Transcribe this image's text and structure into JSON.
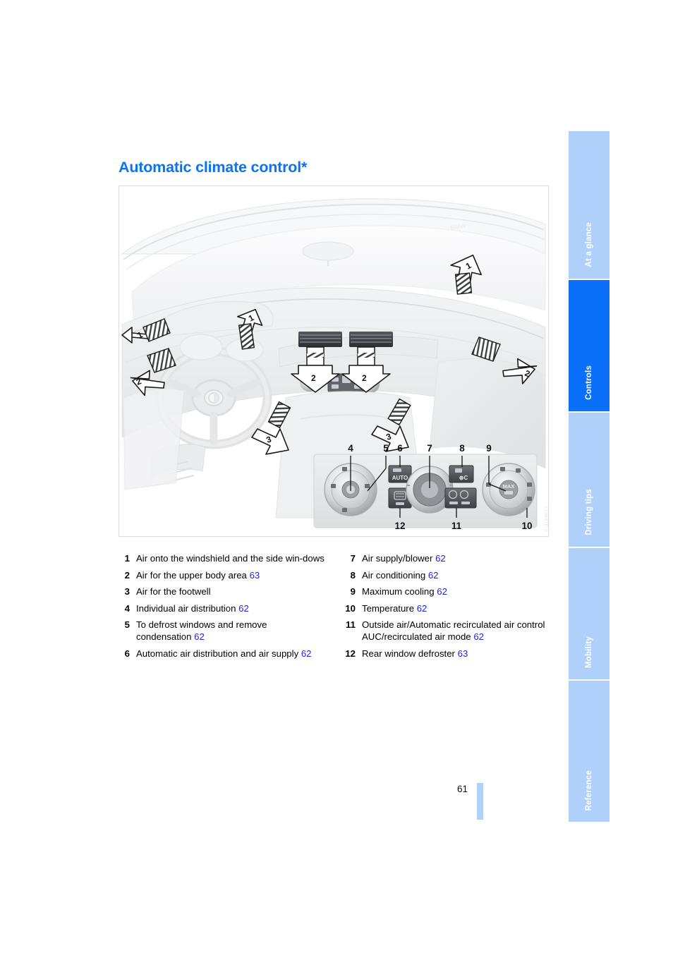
{
  "document": {
    "title": "Automatic climate control*",
    "page_number": "61",
    "figure_id": "CLIMATE-IL"
  },
  "legend": {
    "left": [
      {
        "num": "1",
        "text": "Air onto the windshield and the side win-dows",
        "ref": ""
      },
      {
        "num": "2",
        "text": "Air for the upper body area",
        "ref": "63"
      },
      {
        "num": "3",
        "text": "Air for the footwell",
        "ref": ""
      },
      {
        "num": "4",
        "text": "Individual air distribution",
        "ref": "62"
      },
      {
        "num": "5",
        "text": "To defrost windows and remove condensation",
        "ref": "62"
      },
      {
        "num": "6",
        "text": "Automatic air distribution and air supply",
        "ref": "62"
      }
    ],
    "right": [
      {
        "num": "7",
        "text": "Air supply/blower",
        "ref": "62"
      },
      {
        "num": "8",
        "text": "Air conditioning",
        "ref": "62"
      },
      {
        "num": "9",
        "text": "Maximum cooling",
        "ref": "62"
      },
      {
        "num": "10",
        "text": "Temperature",
        "ref": "62"
      },
      {
        "num": "11",
        "text": "Outside air/Automatic recirculated air control AUC/recirculated air mode",
        "ref": "62"
      },
      {
        "num": "12",
        "text": "Rear window defroster",
        "ref": "63"
      }
    ]
  },
  "sidebar": {
    "tabs": [
      {
        "label": "At a glance",
        "active": false
      },
      {
        "label": "Controls",
        "active": true
      },
      {
        "label": "Driving tips",
        "active": false
      },
      {
        "label": "Mobility",
        "active": false
      },
      {
        "label": "Reference",
        "active": false
      }
    ]
  },
  "figure": {
    "callouts_top": [
      "4",
      "5",
      "6",
      "7",
      "8",
      "9"
    ],
    "callouts_bottom": [
      "12",
      "11",
      "10"
    ],
    "arrow_labels": [
      "1",
      "1",
      "1",
      "2",
      "2",
      "2",
      "2",
      "3",
      "3"
    ],
    "panel_text": {
      "auto": "AUTO",
      "max": "MAX"
    }
  },
  "colors": {
    "title_blue": "#0a74f0",
    "tab_active": "#0a70fa",
    "tab_inactive": "#aed0fb",
    "page_ref": "#2222dd",
    "page_bar": "#aed0fb"
  }
}
